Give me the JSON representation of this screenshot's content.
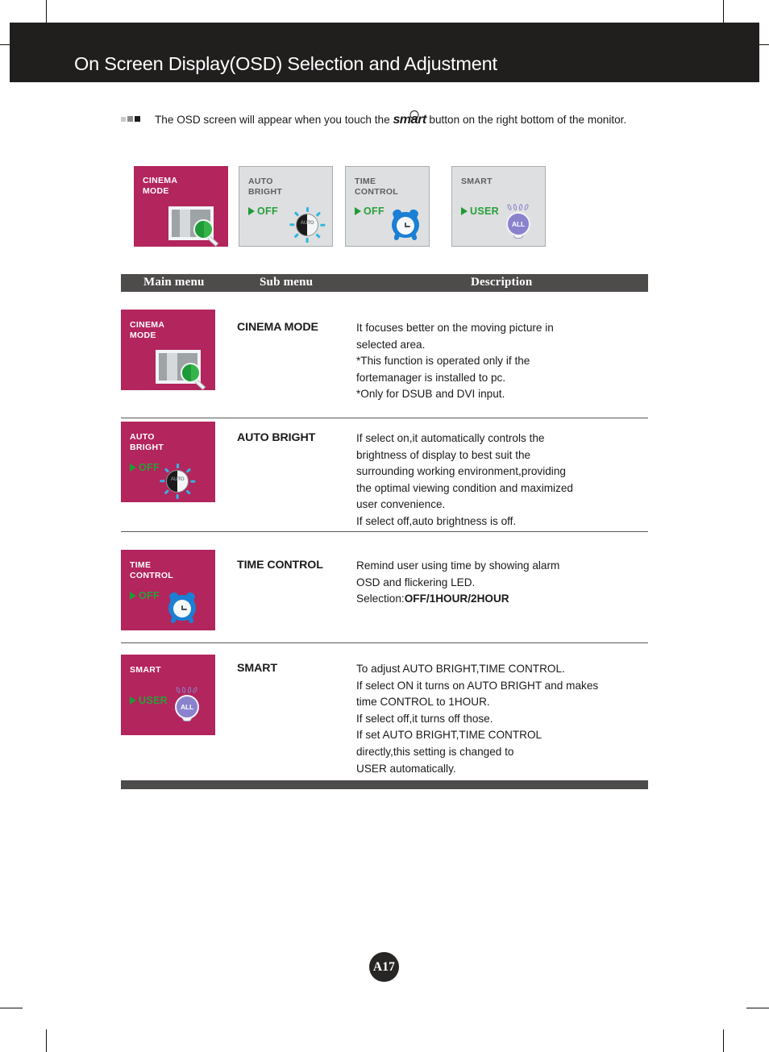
{
  "header": {
    "title": "On Screen Display(OSD) Selection and Adjustment"
  },
  "intro": {
    "text_before": "The OSD screen will appear when you touch the ",
    "logo_prefix": "sm",
    "logo_ring": "a",
    "logo_suffix": "rt",
    "text_after": " button on the right bottom of the monitor."
  },
  "thumbnails": [
    {
      "title": "CINEMA\nMODE",
      "value": "",
      "icon": "cinema-screen-magnifier-icon",
      "style": "magenta"
    },
    {
      "title": "AUTO\nBRIGHT",
      "value": "OFF",
      "icon": "auto-bright-sun-icon",
      "style": "gray"
    },
    {
      "title": "TIME\nCONTROL",
      "value": "OFF",
      "icon": "alarm-clock-icon",
      "style": "gray"
    },
    {
      "title": "SMART",
      "value": "USER",
      "icon": "light-bulb-all-icon",
      "style": "gray"
    }
  ],
  "table": {
    "headers": {
      "main_menu": "Main menu",
      "sub_menu": "Sub menu",
      "description": "Description"
    },
    "rows": [
      {
        "thumb_title": "CINEMA\nMODE",
        "thumb_value": "",
        "icon": "cinema-screen-magnifier-icon",
        "sub_menu": "CINEMA MODE",
        "description": "It focuses better on the moving picture in\nselected area.\n*This function is operated only if the\nfortemanager is installed to pc.\n*Only for DSUB and DVI input."
      },
      {
        "thumb_title": "AUTO\nBRIGHT",
        "thumb_value": "OFF",
        "icon": "auto-bright-sun-icon",
        "sub_menu": "AUTO BRIGHT",
        "description": "If select on,it automatically controls the\nbrightness of display to best suit the\nsurrounding working environment,providing\nthe optimal viewing condition and maximized\nuser convenience.\nIf select off,auto brightness is off."
      },
      {
        "thumb_title": "TIME\nCONTROL",
        "thumb_value": "OFF",
        "icon": "alarm-clock-icon",
        "sub_menu": "TIME CONTROL",
        "description_line1": "Remind user using time by showing alarm",
        "description_line2": "OSD and flickering LED.",
        "description_line3_label": "Selection:",
        "description_line3_value": "OFF/1HOUR/2HOUR"
      },
      {
        "thumb_title": "SMART",
        "thumb_value": "USER",
        "icon": "light-bulb-all-icon",
        "sub_menu": "SMART",
        "description": "To adjust AUTO BRIGHT,TIME CONTROL.\nIf select ON it turns on AUTO BRIGHT and makes\ntime CONTROL to 1HOUR.\nIf select off,it turns off those.\nIf set AUTO BRIGHT,TIME CONTROL\ndirectly,this setting is changed to\nUSER automatically."
      }
    ]
  },
  "footer": {
    "page_number": "A17"
  },
  "colors": {
    "magenta_panel": "#b3255d",
    "gray_panel": "#dddfe0",
    "header_bar": "#211e1e",
    "table_header": "#4e4b4b",
    "green_value": "#28a03a",
    "bulb_purple": "#8a82cd",
    "clock_blue": "#1b7fd4"
  }
}
